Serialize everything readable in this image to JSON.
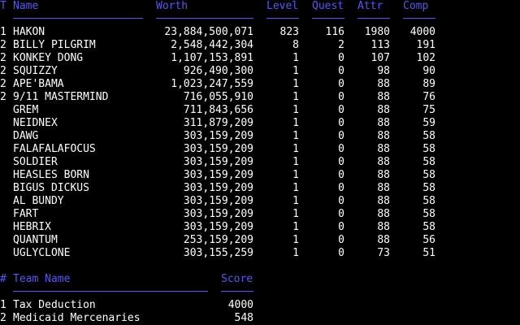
{
  "colors": {
    "background": "#000000",
    "header": "#5555ff",
    "text": "#ffffff"
  },
  "player_headers": {
    "team": "T",
    "name": "Name",
    "worth": "Worth",
    "level": "Level",
    "quest": "Quest",
    "attr": "Attr",
    "comp": "Comp"
  },
  "players": [
    {
      "team": "1",
      "name": "HAKON",
      "worth": "23,884,500,071",
      "level": "823",
      "quest": "116",
      "attr": "1980",
      "comp": "4000"
    },
    {
      "team": "2",
      "name": "BILLY PILGRIM",
      "worth": "2,548,442,304",
      "level": "8",
      "quest": "2",
      "attr": "113",
      "comp": "191"
    },
    {
      "team": "2",
      "name": "KONKEY DONG",
      "worth": "1,107,153,891",
      "level": "1",
      "quest": "0",
      "attr": "107",
      "comp": "102"
    },
    {
      "team": "2",
      "name": "SQUIZZY",
      "worth": "926,490,300",
      "level": "1",
      "quest": "0",
      "attr": "98",
      "comp": "90"
    },
    {
      "team": "2",
      "name": "APE'BAMA",
      "worth": "1,023,247,559",
      "level": "1",
      "quest": "0",
      "attr": "88",
      "comp": "89"
    },
    {
      "team": "2",
      "name": "9/11 MASTERMIND",
      "worth": "716,055,910",
      "level": "1",
      "quest": "0",
      "attr": "88",
      "comp": "76"
    },
    {
      "team": "",
      "name": "GREM",
      "worth": "711,843,656",
      "level": "1",
      "quest": "0",
      "attr": "88",
      "comp": "75"
    },
    {
      "team": "",
      "name": "NEIDNEX",
      "worth": "311,879,209",
      "level": "1",
      "quest": "0",
      "attr": "88",
      "comp": "59"
    },
    {
      "team": "",
      "name": "DAWG",
      "worth": "303,159,209",
      "level": "1",
      "quest": "0",
      "attr": "88",
      "comp": "58"
    },
    {
      "team": "",
      "name": "FALAFALAFOCUS",
      "worth": "303,159,209",
      "level": "1",
      "quest": "0",
      "attr": "88",
      "comp": "58"
    },
    {
      "team": "",
      "name": "SOLDIER",
      "worth": "303,159,209",
      "level": "1",
      "quest": "0",
      "attr": "88",
      "comp": "58"
    },
    {
      "team": "",
      "name": "HEASLES BORN",
      "worth": "303,159,209",
      "level": "1",
      "quest": "0",
      "attr": "88",
      "comp": "58"
    },
    {
      "team": "",
      "name": "BIGUS DICKUS",
      "worth": "303,159,209",
      "level": "1",
      "quest": "0",
      "attr": "88",
      "comp": "58"
    },
    {
      "team": "",
      "name": "AL BUNDY",
      "worth": "303,159,209",
      "level": "1",
      "quest": "0",
      "attr": "88",
      "comp": "58"
    },
    {
      "team": "",
      "name": "FART",
      "worth": "303,159,209",
      "level": "1",
      "quest": "0",
      "attr": "88",
      "comp": "58"
    },
    {
      "team": "",
      "name": "HEBRIX",
      "worth": "303,159,209",
      "level": "1",
      "quest": "0",
      "attr": "88",
      "comp": "58"
    },
    {
      "team": "",
      "name": "QUANTUM",
      "worth": "253,159,209",
      "level": "1",
      "quest": "0",
      "attr": "88",
      "comp": "56"
    },
    {
      "team": "",
      "name": "UGLYCLONE",
      "worth": "303,155,259",
      "level": "1",
      "quest": "0",
      "attr": "73",
      "comp": "51"
    }
  ],
  "team_headers": {
    "number": "#",
    "team_name": "Team Name",
    "score": "Score"
  },
  "teams": [
    {
      "number": "1",
      "team_name": "Tax Deduction",
      "score": "4000"
    },
    {
      "number": "2",
      "team_name": "Medicaid Mercenaries",
      "score": "548"
    }
  ]
}
